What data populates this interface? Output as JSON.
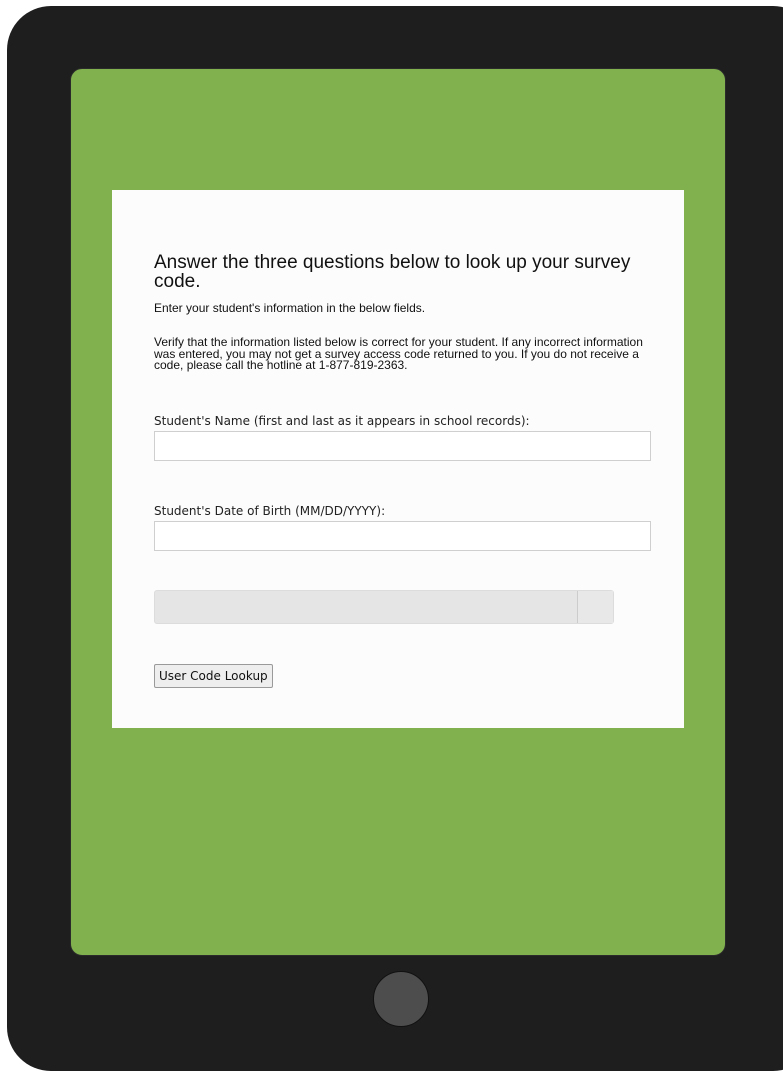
{
  "form": {
    "heading": "Answer the three questions below to look up your survey code.",
    "subtext": "Enter your student's information in the below fields.",
    "verify_text": "Verify that the information listed below is correct for your student. If any incorrect information was entered, you may not get a survey access code returned to you. If you do not receive a code, please call the hotline at 1-877-819-2363.",
    "name_label": "Student's Name (first and last as it appears in school records):",
    "name_value": "",
    "dob_label": "Student's Date of Birth (MM/DD/YYYY):",
    "dob_value": "",
    "submit_label": "User Code Lookup"
  },
  "colors": {
    "device_frame": "#1e1e1e",
    "screen_background": "#81b14f",
    "card_background": "#fcfcfc",
    "home_button": "#4d4d4d"
  }
}
